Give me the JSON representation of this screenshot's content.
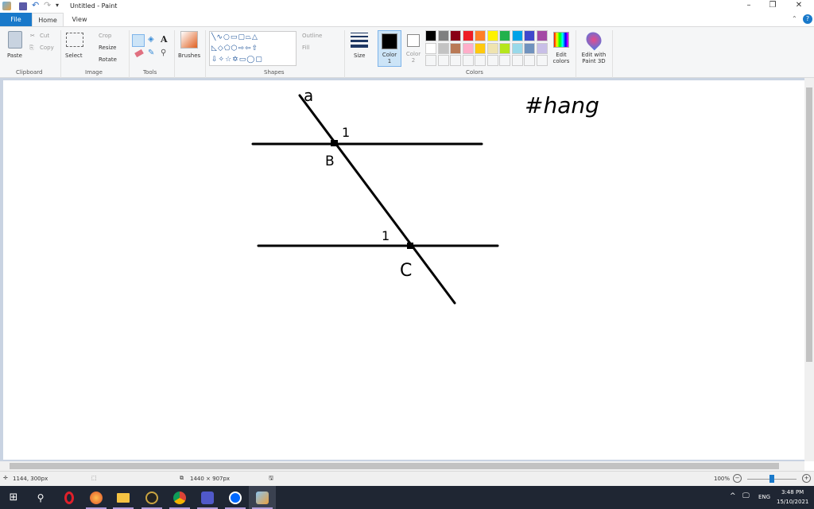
{
  "title": "Untitled - Paint",
  "tabs": {
    "file": "File",
    "home": "Home",
    "view": "View"
  },
  "clipboard": {
    "paste": "Paste",
    "cut": "Cut",
    "copy": "Copy",
    "group": "Clipboard"
  },
  "image": {
    "select": "Select",
    "crop": "Crop",
    "resize": "Resize",
    "rotate": "Rotate",
    "group": "Image"
  },
  "tools": {
    "group": "Tools",
    "text_tool": "A"
  },
  "brushes": {
    "label": "Brushes"
  },
  "shapes": {
    "outline": "Outline",
    "fill": "Fill",
    "group": "Shapes"
  },
  "size": {
    "label": "Size"
  },
  "colors": {
    "color1": "Color",
    "color1_n": "1",
    "color2": "Color",
    "color2_n": "2",
    "group": "Colors",
    "edit": "Edit colors",
    "paint3d": "Edit with Paint 3D",
    "palette_row1": [
      "#000000",
      "#7f7f7f",
      "#880015",
      "#ed1c24",
      "#ff7f27",
      "#fff200",
      "#22b14c",
      "#00a2e8",
      "#3f48cc",
      "#a349a4"
    ],
    "palette_row2": [
      "#ffffff",
      "#c3c3c3",
      "#b97a57",
      "#ffaec9",
      "#ffc90e",
      "#efe4b0",
      "#b5e61d",
      "#99d9ea",
      "#7092be",
      "#c8bfe7"
    ],
    "color1_value": "#000000",
    "color2_value": "#ffffff"
  },
  "drawing": {
    "line_label": "a",
    "angle_b": "1",
    "point_b": "B",
    "angle_c": "1",
    "point_c": "C",
    "note": "#hang"
  },
  "status": {
    "cursor": "1144, 300px",
    "size": "1440 × 907px",
    "zoom": "100%"
  },
  "taskbar": {
    "lang": "ENG",
    "time": "3:48 PM",
    "date": "15/10/2021"
  }
}
